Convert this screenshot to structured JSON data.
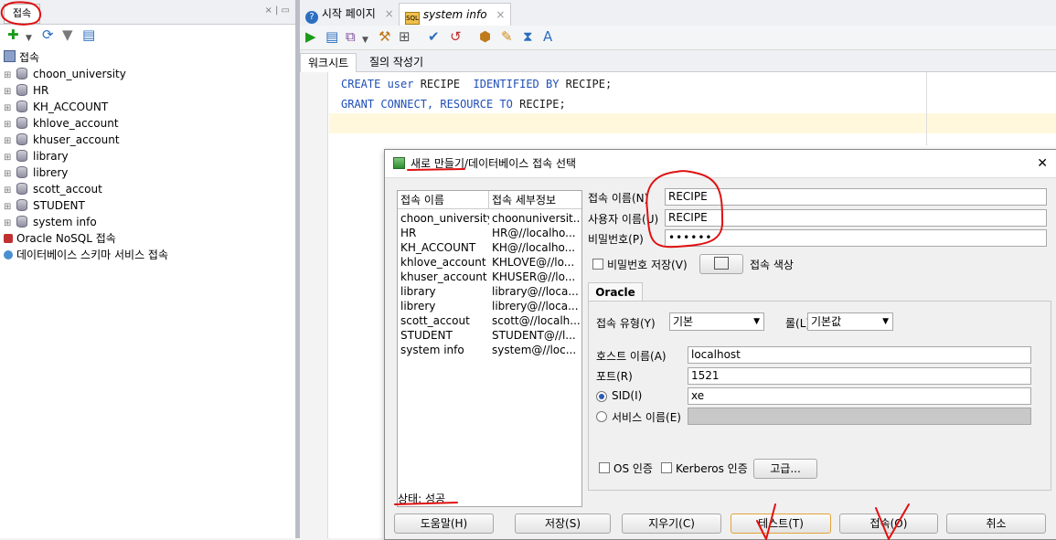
{
  "left_panel": {
    "tab_label": "접속",
    "tab_controls": "× | ▭",
    "tree": {
      "root_label": "접속",
      "connections": [
        "choon_university",
        "HR",
        "KH_ACCOUNT",
        "khlove_account",
        "khuser_account",
        "library",
        "librery",
        "scott_accout",
        "STUDENT",
        "system info"
      ],
      "extra_items": [
        "Oracle NoSQL 접속",
        "데이터베이스 스키마 서비스 접속"
      ]
    }
  },
  "editor": {
    "tabs": [
      "시작 페이지",
      "system info"
    ],
    "sub_tabs": [
      "워크시트",
      "질의 작성기"
    ],
    "code_lines": [
      {
        "kw1": "CREATE user",
        "t1": " RECIPE  ",
        "kw2": "IDENTIFIED BY",
        "t2": " RECIPE;"
      },
      {
        "kw1": "GRANT CONNECT,",
        "t1": " ",
        "kw2": "RESOURCE TO",
        "t2": " RECIPE;"
      }
    ]
  },
  "dialog": {
    "title": "새로 만들기/데이터베이스 접속 선택",
    "close_glyph": "✕",
    "table": {
      "headers": [
        "접속 이름",
        "접속 세부정보"
      ],
      "rows": [
        [
          "choon_university",
          "choonuniversit..."
        ],
        [
          "HR",
          "HR@//localho..."
        ],
        [
          "KH_ACCOUNT",
          "KH@//localho..."
        ],
        [
          "khlove_account",
          "KHLOVE@//lo..."
        ],
        [
          "khuser_account",
          "KHUSER@//lo..."
        ],
        [
          "library",
          "library@//loca..."
        ],
        [
          "librery",
          "librery@//loca..."
        ],
        [
          "scott_accout",
          "scott@//localh..."
        ],
        [
          "STUDENT",
          "STUDENT@//l..."
        ],
        [
          "system info",
          "system@//loc..."
        ]
      ]
    },
    "form": {
      "conn_name_label": "접속 이름(N)",
      "conn_name_value": "RECIPE",
      "user_label": "사용자 이름(U)",
      "user_value": "RECIPE",
      "password_label": "비밀번호(P)",
      "password_value": "••••••",
      "save_password_label": "비밀번호 저장(V)",
      "conn_color_label": "접속 색상",
      "oracle_tab": "Oracle",
      "conn_type_label": "접속 유형(Y)",
      "conn_type_value": "기본",
      "role_label": "롤(L)",
      "role_value": "기본값",
      "host_label": "호스트 이름(A)",
      "host_value": "localhost",
      "port_label": "포트(R)",
      "port_value": "1521",
      "sid_label": "SID(I)",
      "sid_value": "xe",
      "service_label": "서비스 이름(E)",
      "os_auth_label": "OS 인증",
      "kerberos_label": "Kerberos 인증",
      "advanced_label": "고급..."
    },
    "status": "상태: 성공",
    "buttons": {
      "help": "도움말(H)",
      "save": "저장(S)",
      "clear": "지우기(C)",
      "test": "테스트(T)",
      "connect": "접속(O)",
      "cancel": "취소"
    }
  },
  "colors": {
    "keyword": "#1f4fb7",
    "annotation": "#e01010",
    "selection_bar": "#2b5bb5"
  }
}
